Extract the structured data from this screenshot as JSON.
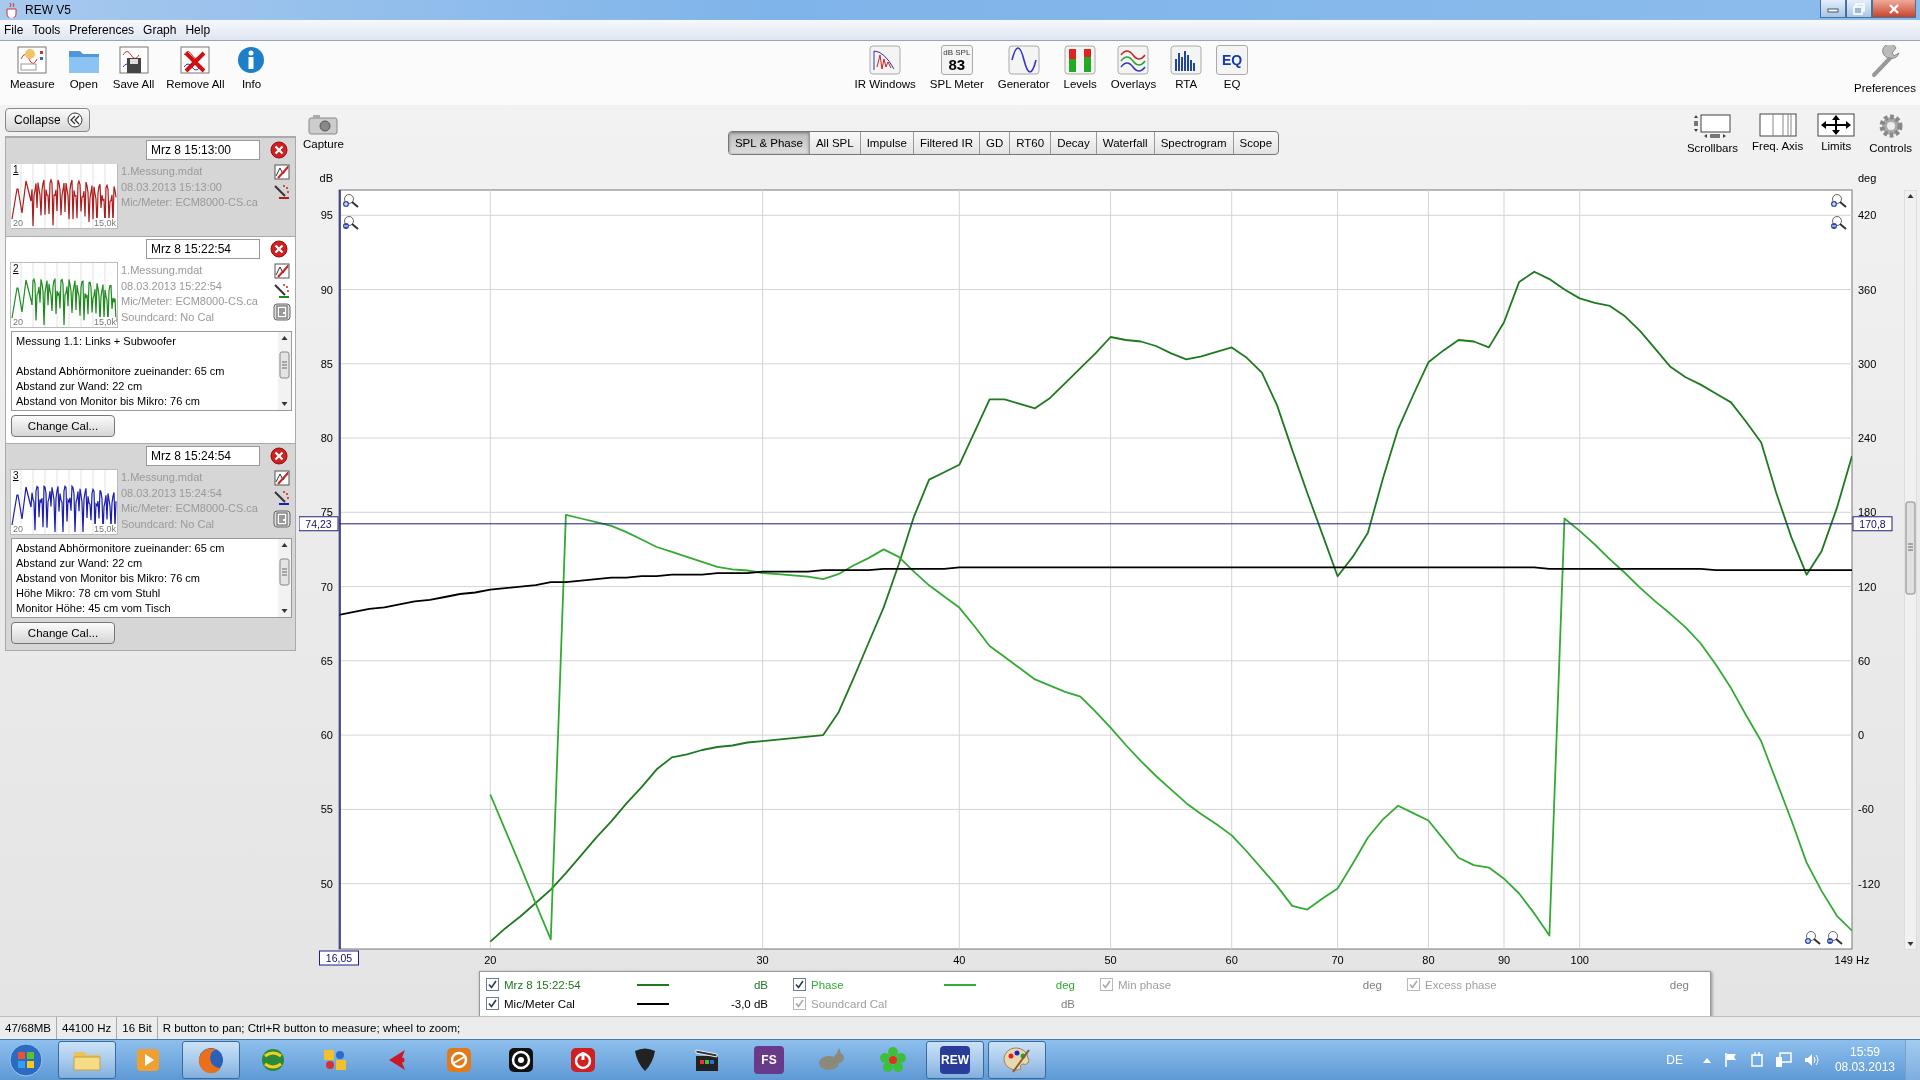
{
  "window": {
    "title": "REW V5"
  },
  "menu": [
    "File",
    "Tools",
    "Preferences",
    "Graph",
    "Help"
  ],
  "toolbar": {
    "left": [
      {
        "label": "Measure",
        "kind": "measure"
      },
      {
        "label": "Open",
        "kind": "open"
      },
      {
        "label": "Save All",
        "kind": "save"
      },
      {
        "label": "Remove All",
        "kind": "remove"
      },
      {
        "label": "Info",
        "kind": "info"
      }
    ],
    "center": [
      {
        "label": "IR Windows",
        "kind": "ir"
      },
      {
        "label": "SPL Meter",
        "kind": "spl",
        "badge": [
          "dB SPL",
          "83"
        ]
      },
      {
        "label": "Generator",
        "kind": "generator"
      },
      {
        "label": "Levels",
        "kind": "levels"
      },
      {
        "label": "Overlays",
        "kind": "overlays"
      },
      {
        "label": "RTA",
        "kind": "rta"
      },
      {
        "label": "EQ",
        "kind": "eq",
        "badge": [
          "EQ"
        ]
      }
    ],
    "right": [
      {
        "label": "Preferences",
        "kind": "preferences"
      }
    ]
  },
  "collapse_button": "Collapse",
  "measurements": [
    {
      "number": "1",
      "date": "Mrz 8 15:13:00",
      "file": "1.Messung.mdat",
      "timestamp": "08.03.2013 15:13:00",
      "mic": "Mic/Meter: ECM8000-CS.ca",
      "color": "#b01c1c",
      "selected": false,
      "collapsed": true,
      "thumb_start": "20",
      "thumb_end": "15,0k"
    },
    {
      "number": "2",
      "date": "Mrz 8 15:22:54",
      "file": "1.Messung.mdat",
      "timestamp": "08.03.2013 15:22:54",
      "mic": "Mic/Meter: ECM8000-CS.ca",
      "soundcard": "Soundcard: No Cal",
      "color": "#1e8a1e",
      "selected": true,
      "collapsed": false,
      "thumb_start": "20",
      "thumb_end": "15,0k",
      "notes": [
        [
          "Messung 1.1: Links + Subwoofer"
        ],
        [
          "Abstand Abhörmonitore zueinander: 65 cm",
          "Abstand zur Wand: 22 cm",
          "Abstand von Monitor bis Mikro: 76 cm"
        ]
      ],
      "button": "Change Cal..."
    },
    {
      "number": "3",
      "date": "Mrz 8 15:24:54",
      "file": "1.Messung.mdat",
      "timestamp": "08.03.2013 15:24:54",
      "mic": "Mic/Meter: ECM8000-CS.ca",
      "soundcard": "Soundcard: No Cal",
      "color": "#1c1cb0",
      "selected": false,
      "collapsed": false,
      "thumb_start": "20",
      "thumb_end": "15,0k",
      "notes": [
        [
          "Abstand Abhörmonitore zueinander: 65 cm",
          "Abstand zur Wand: 22 cm",
          "Abstand von Monitor bis Mikro: 76 cm",
          "Höhe Mikro: 78 cm vom Stuhl",
          "Monitor Höhe: 45 cm vom Tisch"
        ]
      ],
      "button": "Change Cal..."
    }
  ],
  "graph": {
    "capture": {
      "label": "Capture",
      "kind": "capture"
    },
    "tabs": [
      {
        "label": "SPL & Phase",
        "selected": true
      },
      {
        "label": "All SPL",
        "selected": false
      },
      {
        "label": "Impulse",
        "selected": false
      },
      {
        "label": "Filtered IR",
        "selected": false
      },
      {
        "label": "GD",
        "selected": false
      },
      {
        "label": "RT60",
        "selected": false
      },
      {
        "label": "Decay",
        "selected": false
      },
      {
        "label": "Waterfall",
        "selected": false
      },
      {
        "label": "Spectrogram",
        "selected": false
      },
      {
        "label": "Scope",
        "selected": false
      }
    ],
    "controls": [
      {
        "label": "Scrollbars",
        "kind": "scrollbars"
      },
      {
        "label": "Freq. Axis",
        "kind": "freqaxis"
      },
      {
        "label": "Limits",
        "kind": "limits"
      },
      {
        "label": "Controls",
        "kind": "controls"
      }
    ],
    "chart_data": {
      "type": "line",
      "ylabel": "dB",
      "y2label": "deg",
      "categories": [
        null,
        null,
        null,
        null,
        null,
        null,
        null,
        null,
        null,
        null,
        "20",
        null,
        null,
        null,
        null,
        null,
        null,
        null,
        null,
        null,
        null,
        null,
        null,
        null,
        null,
        null,
        null,
        null,
        "30",
        null,
        null,
        null,
        null,
        null,
        null,
        null,
        null,
        null,
        null,
        null,
        null,
        "40",
        null,
        null,
        null,
        null,
        null,
        null,
        null,
        null,
        null,
        "50",
        null,
        null,
        null,
        null,
        null,
        null,
        null,
        "60",
        null,
        null,
        null,
        null,
        null,
        null,
        "70",
        null,
        null,
        null,
        null,
        null,
        "80",
        null,
        null,
        null,
        null,
        "90",
        null,
        null,
        null,
        null,
        "100",
        null,
        null,
        null,
        null,
        null,
        null,
        null,
        null,
        null,
        null,
        null,
        null,
        null,
        null,
        null,
        null,
        null,
        "149 Hz"
      ],
      "ylim": [
        45.6,
        96.7
      ],
      "y2lim": [
        -172.8,
        440.4
      ],
      "yticks": [
        50,
        55,
        60,
        65,
        70,
        75,
        80,
        85,
        90,
        95
      ],
      "y2ticks": [
        -120,
        -60,
        0,
        60,
        120,
        180,
        240,
        300,
        360,
        420
      ],
      "series": [
        {
          "name": "Mrz 8 15:22:54",
          "color": "#1e7a1e",
          "values": [
            null,
            null,
            null,
            null,
            null,
            null,
            null,
            null,
            null,
            null,
            46.1,
            47.0,
            47.8,
            48.7,
            49.6,
            50.7,
            51.9,
            53.1,
            54.2,
            55.4,
            56.5,
            57.7,
            58.5,
            58.7,
            59.0,
            59.2,
            59.3,
            59.5,
            59.6,
            59.7,
            59.8,
            59.9,
            60.0,
            61.5,
            63.8,
            66.2,
            68.6,
            71.5,
            74.7,
            77.2,
            77.7,
            78.2,
            80.4,
            82.6,
            82.6,
            82.3,
            82.0,
            82.7,
            83.7,
            84.7,
            85.7,
            86.8,
            86.6,
            86.5,
            86.2,
            85.7,
            85.3,
            85.5,
            85.8,
            86.1,
            85.4,
            84.4,
            82.2,
            79.2,
            76.3,
            73.5,
            70.7,
            72.0,
            73.6,
            77.3,
            80.6,
            82.9,
            85.1,
            85.9,
            86.6,
            86.5,
            86.1,
            87.8,
            90.5,
            91.2,
            90.7,
            90.0,
            89.4,
            89.1,
            88.9,
            88.2,
            87.2,
            86.0,
            84.8,
            84.1,
            83.6,
            83.0,
            82.4,
            81.1,
            79.7,
            76.3,
            73.3,
            70.8,
            72.4,
            75.3,
            78.8
          ]
        },
        {
          "name": "Phase",
          "color": "#33aa33",
          "axis": "y2",
          "values": [
            null,
            null,
            null,
            null,
            null,
            null,
            null,
            null,
            null,
            null,
            -48,
            -77,
            -106,
            -136,
            -165,
            178,
            175,
            172,
            169,
            164,
            158,
            152,
            148,
            144,
            140,
            136,
            134,
            133,
            131,
            130,
            129,
            128,
            126,
            130,
            137,
            143,
            150,
            144,
            132,
            121,
            112,
            103,
            88,
            72,
            63,
            54,
            45,
            40,
            35,
            31,
            19,
            6,
            -8,
            -21,
            -33,
            -44,
            -55,
            -64,
            -72,
            -81,
            -94,
            -108,
            -122,
            -138,
            -141,
            -132,
            -124,
            -104,
            -83,
            -68,
            -57,
            -63,
            -69,
            -84,
            -99,
            -105,
            -107,
            -116,
            -128,
            -144,
            -162,
            175,
            165,
            154,
            142,
            131,
            119,
            108,
            98,
            87,
            74,
            57,
            38,
            16,
            -5,
            -37,
            -69,
            -103,
            -126,
            -146,
            -158
          ]
        },
        {
          "name": "Mic/Meter Cal",
          "color": "#000000",
          "values": [
            68.1,
            68.3,
            68.5,
            68.6,
            68.8,
            69.0,
            69.1,
            69.3,
            69.5,
            69.6,
            69.8,
            69.9,
            70.0,
            70.1,
            70.3,
            70.3,
            70.4,
            70.5,
            70.6,
            70.6,
            70.7,
            70.7,
            70.8,
            70.8,
            70.8,
            70.9,
            70.9,
            70.9,
            71.0,
            71.0,
            71.0,
            71.0,
            71.1,
            71.1,
            71.1,
            71.1,
            71.2,
            71.2,
            71.2,
            71.2,
            71.2,
            71.3,
            71.3,
            71.3,
            71.3,
            71.3,
            71.3,
            71.3,
            71.3,
            71.3,
            71.3,
            71.3,
            71.3,
            71.3,
            71.3,
            71.3,
            71.3,
            71.3,
            71.3,
            71.3,
            71.3,
            71.3,
            71.3,
            71.3,
            71.3,
            71.3,
            71.3,
            71.3,
            71.3,
            71.3,
            71.3,
            71.3,
            71.3,
            71.3,
            71.3,
            71.3,
            71.3,
            71.3,
            71.3,
            71.3,
            71.2,
            71.2,
            71.2,
            71.2,
            71.2,
            71.2,
            71.2,
            71.2,
            71.2,
            71.2,
            71.2,
            71.1,
            71.1,
            71.1,
            71.1,
            71.1,
            71.1,
            71.1,
            71.1,
            71.1,
            71.1
          ]
        }
      ],
      "grid": true,
      "ref_lines": [
        {
          "axis": "y",
          "value": 74.23,
          "label": "74,23"
        }
      ],
      "annotations": [
        {
          "text": "170,8"
        },
        {
          "text": "16,05"
        }
      ]
    }
  },
  "legend": {
    "rows": [
      [
        {
          "kind": "series",
          "checked": true,
          "disabled": false,
          "unit": "dB"
        },
        {
          "kind": "series",
          "checked": true,
          "disabled": false,
          "unit": "deg"
        },
        {
          "kind": "label",
          "label": "Min phase",
          "checked": true,
          "disabled": true,
          "unit": "deg"
        },
        {
          "kind": "label",
          "label": "Excess phase",
          "checked": true,
          "disabled": true,
          "unit": "deg"
        }
      ],
      [
        {
          "kind": "series",
          "checked": true,
          "disabled": false,
          "unit": "-3,0 dB"
        },
        {
          "kind": "label",
          "label": "Soundcard Cal",
          "checked": true,
          "disabled": true,
          "unit": "dB"
        }
      ]
    ]
  },
  "status_bar": [
    "47/68MB",
    "44100 Hz",
    "16 Bit",
    "R button to pan; Ctrl+R button to measure; wheel to zoom;"
  ],
  "taskbar": {
    "items": [
      {
        "kind": "folder",
        "selected": true
      },
      {
        "kind": "media",
        "selected": false
      },
      {
        "kind": "firefox",
        "selected": true
      },
      {
        "kind": "globe",
        "selected": false
      },
      {
        "kind": "puzzle",
        "selected": false
      },
      {
        "kind": "arrow",
        "selected": false
      },
      {
        "kind": "ring",
        "selected": false
      },
      {
        "kind": "target",
        "selected": false
      },
      {
        "kind": "power",
        "selected": false
      },
      {
        "kind": "pick",
        "selected": false
      },
      {
        "kind": "clapper",
        "selected": false
      },
      {
        "kind": "tile",
        "label": "FS",
        "color": "#6a3a8a",
        "selected": false
      },
      {
        "kind": "creature",
        "selected": false
      },
      {
        "kind": "flower",
        "selected": false
      },
      {
        "kind": "tile",
        "label": "REW",
        "color": "#2a3c9a",
        "selected": true
      },
      {
        "kind": "palette",
        "selected": true
      }
    ],
    "tray": {
      "language": "DE",
      "time": "15:59",
      "date": "08.03.2013"
    }
  }
}
